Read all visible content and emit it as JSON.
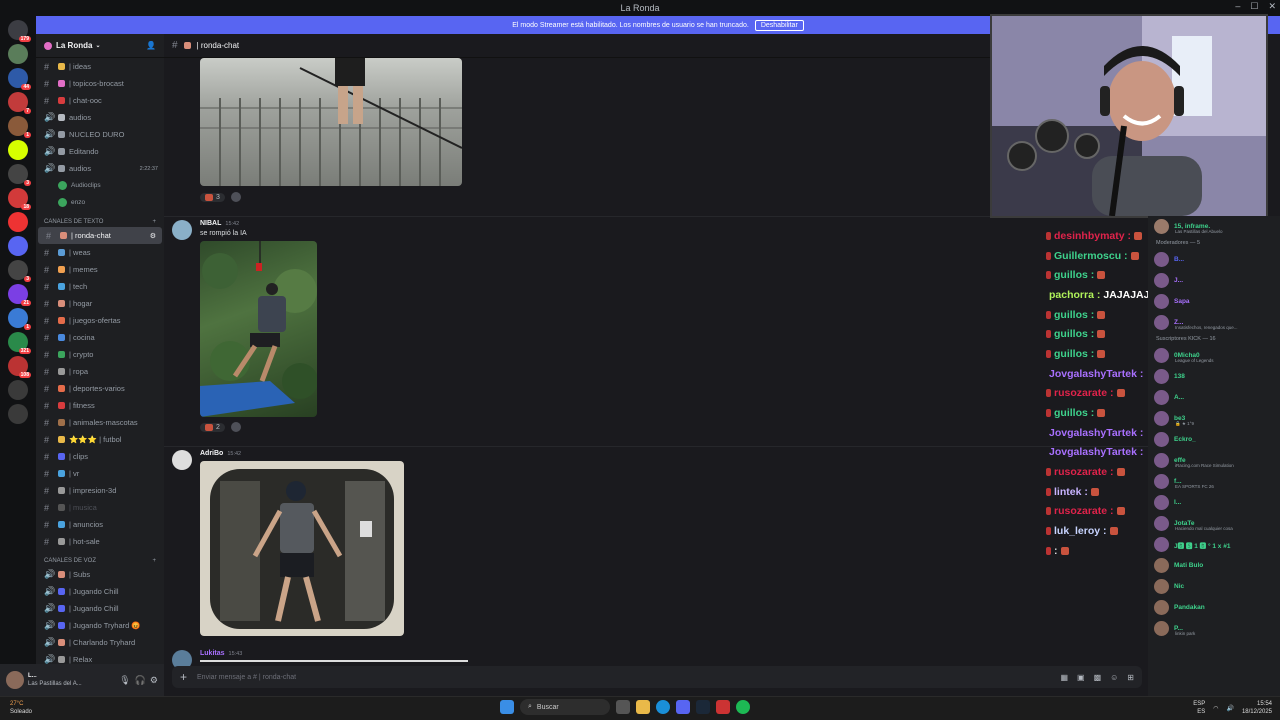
{
  "window": {
    "title": "La Ronda",
    "controls": [
      "–",
      "☐",
      "✕"
    ]
  },
  "banner": {
    "text": "El modo Streamer está habilitado. Los nombres de usuario se han truncado.",
    "button": "Deshabilitar"
  },
  "guilds": [
    {
      "color": "#3c3d43",
      "badge": "179"
    },
    {
      "color": "#5a7d5a",
      "badge": ""
    },
    {
      "color": "#2e5aa8",
      "badge": "44"
    },
    {
      "color": "#c23b3b",
      "badge": "7"
    },
    {
      "color": "#8a5a3a",
      "badge": "1"
    },
    {
      "color": "#d6ff00",
      "badge": ""
    },
    {
      "color": "#444",
      "badge": "3"
    },
    {
      "color": "#d23a3a",
      "badge": "18"
    },
    {
      "color": "#e33",
      "badge": ""
    },
    {
      "color": "#5865f2",
      "badge": ""
    },
    {
      "color": "#444",
      "badge": "3"
    },
    {
      "color": "#7b3fe4",
      "badge": "21"
    },
    {
      "color": "#3a7bd5",
      "badge": "1"
    },
    {
      "color": "#2a8a4a",
      "badge": "321"
    },
    {
      "color": "#b33",
      "badge": "108"
    },
    {
      "color": "#3a3a3a",
      "badge": ""
    },
    {
      "color": "#3a3a3a",
      "badge": ""
    }
  ],
  "sidebar": {
    "server_name": "La Ronda",
    "top_channels": [
      {
        "label": "| ideas",
        "color": "#e9b949"
      },
      {
        "label": "| topicos-brocast",
        "color": "#e26ec6"
      },
      {
        "label": "| chat-ooc",
        "color": "#d83c3e"
      }
    ],
    "voice_top": [
      {
        "label": "audios",
        "color": "#b5bac1"
      },
      {
        "label": "NUCLEO DURO",
        "color": "#949ba4"
      },
      {
        "label": "Editando",
        "color": "#949ba4"
      },
      {
        "label": "audios",
        "color": "#949ba4",
        "time": "2:22:37"
      }
    ],
    "voice_users": [
      {
        "label": "Audioclips"
      },
      {
        "label": "enzo"
      }
    ],
    "text_category": "CANALES DE TEXTO",
    "text_channels": [
      {
        "label": "| ronda-chat",
        "color": "#d98e7a",
        "selected": true
      },
      {
        "label": "| weas",
        "color": "#5b9bd5"
      },
      {
        "label": "| memes",
        "color": "#f0a050"
      },
      {
        "label": "| tech",
        "color": "#4aa3df"
      },
      {
        "label": "| hogar",
        "color": "#d98e7a"
      },
      {
        "label": "| juegos-ofertas",
        "color": "#e56c4a"
      },
      {
        "label": "| cocina",
        "color": "#4a8adf"
      },
      {
        "label": "| crypto",
        "color": "#3ba55d"
      },
      {
        "label": "| ropa",
        "color": "#999"
      },
      {
        "label": "| deportes-varios",
        "color": "#e56c4a"
      },
      {
        "label": "| fitness",
        "color": "#d83c3e"
      },
      {
        "label": "| animales-mascotas",
        "color": "#a0704a"
      },
      {
        "label": "⭐⭐⭐ | futbol",
        "color": "#e9b949"
      },
      {
        "label": "| clips",
        "color": "#5865f2"
      },
      {
        "label": "| vr",
        "color": "#4aa3df"
      },
      {
        "label": "| impresion-3d",
        "color": "#999"
      },
      {
        "label": "| musica",
        "color": "#555",
        "muted": true
      },
      {
        "label": "| anuncios",
        "color": "#4aa3df"
      },
      {
        "label": "| hot-sale",
        "color": "#999"
      }
    ],
    "voice_category": "Canales de voz",
    "voice_channels": [
      {
        "label": "| Subs",
        "color": "#d98e7a"
      },
      {
        "label": "| Jugando Chill",
        "color": "#5865f2"
      },
      {
        "label": "| Jugando Chill",
        "color": "#5865f2"
      },
      {
        "label": "| Jugando Tryhard 😡",
        "color": "#5865f2"
      },
      {
        "label": "| Charlando Tryhard",
        "color": "#d98e7a"
      },
      {
        "label": "| Relax",
        "color": "#999"
      }
    ]
  },
  "user_panel": {
    "name": "L...",
    "status": "Las Pastillas del A..."
  },
  "channel_header": {
    "name": "| ronda-chat"
  },
  "messages": [
    {
      "reaction_count": "3"
    },
    {
      "author": "NIBAL",
      "time": "15:42",
      "text": "se rompió la IA",
      "reaction_count": "2"
    },
    {
      "author": "AdriBo",
      "time": "15:42"
    },
    {
      "author": "Lukitas",
      "time": "15:43"
    }
  ],
  "composer": {
    "placeholder": "Enviar mensaje a #  | ronda-chat"
  },
  "stream_chat": [
    {
      "name": "desinhbymaty :",
      "color": "#e0234b",
      "badge": "#c9533e"
    },
    {
      "name": "Guillermoscu :",
      "color": "#3ed28c",
      "badge": "#c9533e"
    },
    {
      "name": "guillos :",
      "color": "#3ed28c",
      "badge": "#c9533e"
    },
    {
      "name": "pachorra :",
      "color": "#b0f25a",
      "text": "JAJAJAJAJJAJA"
    },
    {
      "name": "guillos :",
      "color": "#3ed28c",
      "badge": "#c9533e"
    },
    {
      "name": "guillos :",
      "color": "#3ed28c",
      "badge": "#c9533e"
    },
    {
      "name": "guillos :",
      "color": "#3ed28c",
      "badge": "#c9533e"
    },
    {
      "name": "JovgalashyTartek :",
      "color": "#a970ff",
      "badge": "#c9533e"
    },
    {
      "name": "rusozarate :",
      "color": "#e0234b",
      "badge": "#c9533e"
    },
    {
      "name": "guillos :",
      "color": "#3ed28c",
      "badge": "#c9533e"
    },
    {
      "name": "JovgalashyTartek :",
      "color": "#a970ff",
      "badge": "#c9533e"
    },
    {
      "name": "JovgalashyTartek :",
      "color": "#a970ff",
      "badge": "#c9533e"
    },
    {
      "name": "rusozarate :",
      "color": "#e0234b",
      "badge": "#c9533e"
    },
    {
      "name": "lintek :",
      "color": "#c8b4ff",
      "badge": "#c9533e"
    },
    {
      "name": "rusozarate :",
      "color": "#e0234b",
      "badge": "#c9533e"
    },
    {
      "name": "luk_leroy :",
      "color": "#c8d4ff",
      "badge": "#c9533e"
    },
    {
      "name": ":",
      "color": "#dbdee1",
      "badge": "#c9533e"
    }
  ],
  "members": {
    "top": [
      {
        "name": "15, inframe.",
        "activity": "Las Pastillas del Abuelo",
        "color": "#3ed28c"
      }
    ],
    "mods_label": "Moderadores — 5",
    "mods": [
      {
        "name": "B...",
        "color": "#5865f2"
      },
      {
        "name": "J...",
        "color": "#a970ff"
      },
      {
        "name": "Sapa",
        "color": "#a970ff"
      },
      {
        "name": "Z...",
        "color": "#a970ff",
        "activity": "Insatisfechos, renegados que..."
      }
    ],
    "subs_label": "Suscriptores KICK — 16",
    "subs": [
      {
        "name": "0Micha0",
        "color": "#3ed28c",
        "activity": "League of Legends"
      },
      {
        "name": "138",
        "color": "#3ed28c"
      },
      {
        "name": "A...",
        "color": "#3ed28c"
      },
      {
        "name": "be3",
        "color": "#3ed28c",
        "activity": "🔒 ★ 1°9"
      },
      {
        "name": "Eckro_",
        "color": "#3ed28c"
      },
      {
        "name": "effe",
        "color": "#3ed28c",
        "activity": "iRacing.com Race Simulation"
      },
      {
        "name": "f...",
        "color": "#3ed28c",
        "activity": "EA SPORTS FC 26"
      },
      {
        "name": "I...",
        "color": "#3ed28c"
      },
      {
        "name": "JotaTe",
        "color": "#3ed28c",
        "activity": "Haciendo mal cualquier cosa"
      },
      {
        "name": "J🅱 🆂 1 🅱 ° 1 x #1",
        "color": "#3ed28c"
      },
      {
        "name": "Mati Bulo",
        "color": "#3ed28c"
      },
      {
        "name": "Nic",
        "color": "#3ed28c"
      },
      {
        "name": "Pandakan",
        "color": "#3ed28c"
      },
      {
        "name": "P...",
        "color": "#3ed28c",
        "activity": "linkin park"
      }
    ]
  },
  "taskbar": {
    "weather_temp": "27°C",
    "weather_desc": "Soleado",
    "search": "Buscar",
    "lang": "ESP",
    "lang2": "ES",
    "time": "15:54",
    "date": "18/12/2025"
  }
}
